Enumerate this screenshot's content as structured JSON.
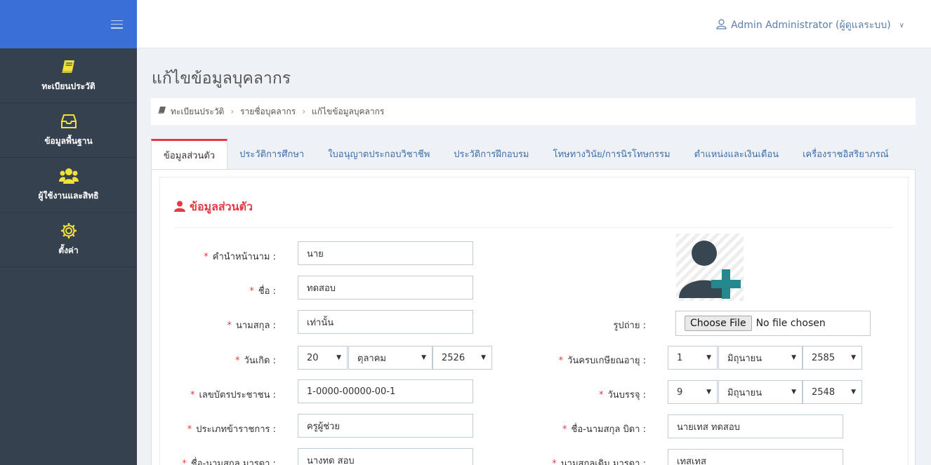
{
  "sidebar": {
    "items": [
      {
        "label": "ทะเบียนประวัติ",
        "icon": "book-icon"
      },
      {
        "label": "ข้อมูลพื้นฐาน",
        "icon": "inbox-icon"
      },
      {
        "label": "ผู้ใช้งานและสิทธิ",
        "icon": "users-icon"
      },
      {
        "label": "ตั้งค่า",
        "icon": "gear-icon"
      }
    ]
  },
  "header": {
    "user": "Admin Administrator (ผู้ดูแลระบบ)"
  },
  "page": {
    "title": "แก้ไขข้อมูลบุคลากร"
  },
  "breadcrumb": [
    "ทะเบียนประวัติ",
    "รายชื่อบุคลากร",
    "แก้ไขข้อมูลบุคลากร"
  ],
  "tabs": [
    "ข้อมูลส่วนตัว",
    "ประวัติการศึกษา",
    "ใบอนุญาตประกอบวิชาชีพ",
    "ประวัติการฝึกอบรม",
    "โทษทางวินัย/การนิรโทษกรรม",
    "ตำแหน่งและเงินเดือน",
    "เครื่องราชอิสริยาภรณ์"
  ],
  "section": {
    "title": "ข้อมูลส่วนตัว"
  },
  "form": {
    "prefix": {
      "label": "คำนำหน้านาม :",
      "value": "นาย"
    },
    "first_name": {
      "label": "ชื่อ :",
      "value": "ทดสอบ"
    },
    "last_name": {
      "label": "นามสกุล :",
      "value": "เท่านั้น"
    },
    "birth_date": {
      "label": "วันเกิด :",
      "day": "20",
      "month": "ตุลาคม",
      "year": "2526"
    },
    "id_card": {
      "label": "เลขบัตรประชาชน :",
      "value": "1-0000-00000-00-1"
    },
    "civil_type": {
      "label": "ประเภทข้าราชการ :",
      "value": "ครูผู้ช่วย"
    },
    "mother_name": {
      "label": "ชื่อ-นามสกุล มารดา :",
      "value": "นางทด สอบ"
    },
    "photo": {
      "label": "รูปถ่าย :",
      "button": "Choose File",
      "status": "No file chosen"
    },
    "retire_date": {
      "label": "วันครบเกษียณอายุ :",
      "day": "1",
      "month": "มิถุนายน",
      "year": "2585"
    },
    "appoint_date": {
      "label": "วันบรรจุ :",
      "day": "9",
      "month": "มิถุนายน",
      "year": "2548"
    },
    "father_name": {
      "label": "ชื่อ-นามสกุล บิดา :",
      "value": "นายเทส ทดสอบ"
    },
    "mother_maiden": {
      "label": "นามสกุลเดิม มารดา :",
      "value": "เทสเทส"
    }
  },
  "colors": {
    "sidebar": "#364150",
    "sidebar_head": "#3a6fd8",
    "accent_red": "#e43a45",
    "nav_icon": "#f1e23b",
    "link": "#3d6ea8"
  }
}
